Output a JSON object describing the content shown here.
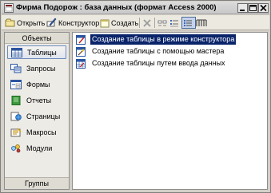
{
  "window": {
    "title": "Фирма Подорож : база данных (формат Access 2000)"
  },
  "toolbar": {
    "open_label": "Открыть",
    "designer_label": "Конструктор",
    "create_label": "Создать"
  },
  "sidebar": {
    "header": "Объекты",
    "footer": "Группы",
    "items": [
      {
        "label": "Таблицы",
        "icon": "table-icon",
        "selected": true
      },
      {
        "label": "Запросы",
        "icon": "query-icon"
      },
      {
        "label": "Формы",
        "icon": "form-icon"
      },
      {
        "label": "Отчеты",
        "icon": "report-icon"
      },
      {
        "label": "Страницы",
        "icon": "page-icon"
      },
      {
        "label": "Макросы",
        "icon": "macro-icon"
      },
      {
        "label": "Модули",
        "icon": "module-icon"
      }
    ]
  },
  "list": {
    "items": [
      {
        "label": "Создание таблицы в режиме конструктора",
        "selected": true
      },
      {
        "label": "Создание таблицы с помощью мастера"
      },
      {
        "label": "Создание таблицы путем ввода данных"
      }
    ]
  },
  "colors": {
    "selection": "#0a246a",
    "window_bg": "#d4d0c8"
  }
}
